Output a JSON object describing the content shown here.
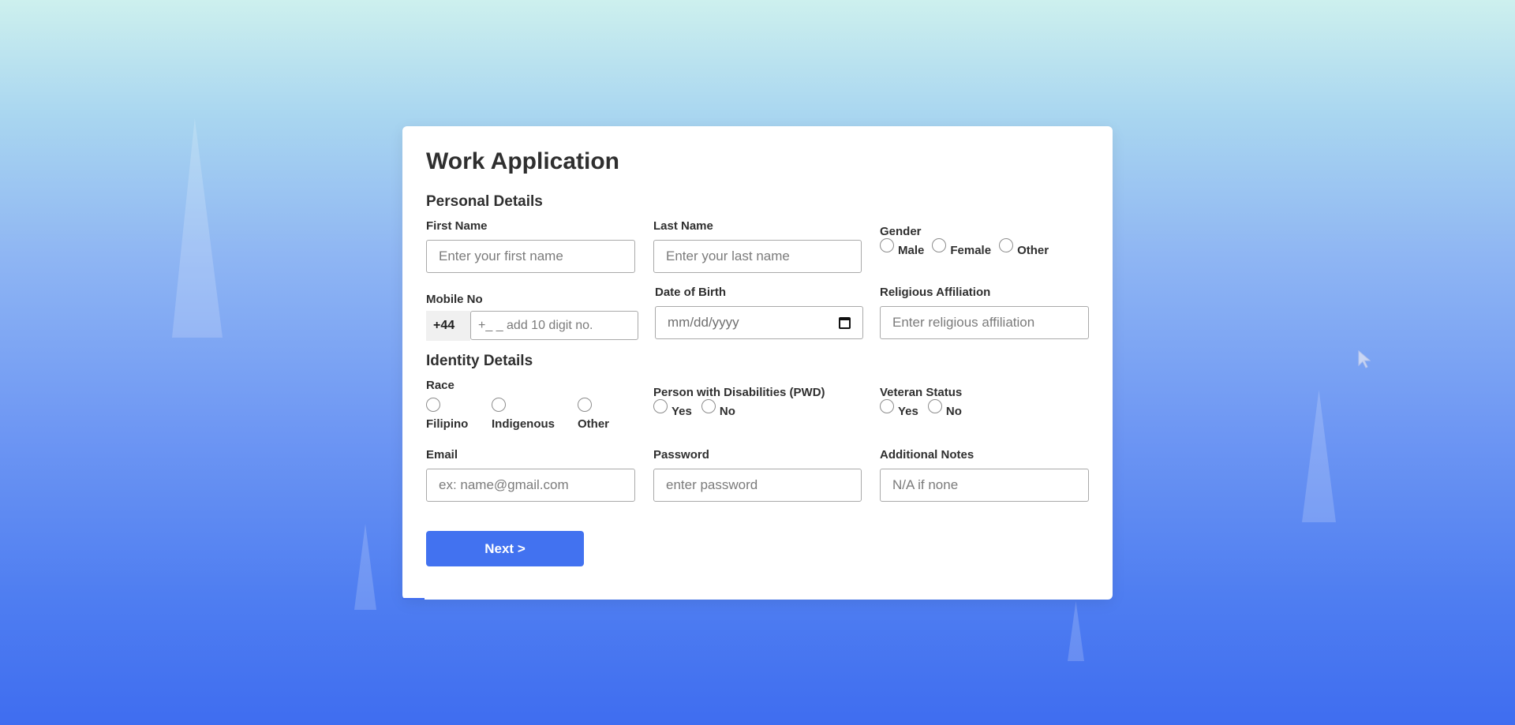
{
  "form": {
    "title": "Work Application",
    "personal_heading": "Personal Details",
    "identity_heading": "Identity Details",
    "first_name": {
      "label": "First Name",
      "placeholder": "Enter your first name"
    },
    "last_name": {
      "label": "Last Name",
      "placeholder": "Enter your last name"
    },
    "gender": {
      "label": "Gender",
      "options": [
        "Male",
        "Female",
        "Other"
      ]
    },
    "mobile": {
      "label": "Mobile No",
      "prefix": "+44",
      "placeholder": "+_ _ add 10 digit no."
    },
    "dob": {
      "label": "Date of Birth",
      "placeholder": "mm/dd/yyyy",
      "icon": "calendar-icon"
    },
    "religion": {
      "label": "Religious Affiliation",
      "placeholder": "Enter religious affiliation"
    },
    "race": {
      "label": "Race",
      "options": [
        "Filipino",
        "Indigenous",
        "Other"
      ]
    },
    "pwd": {
      "label": "Person with Disabilities (PWD)",
      "options": [
        "Yes",
        "No"
      ]
    },
    "veteran": {
      "label": "Veteran Status",
      "options": [
        "Yes",
        "No"
      ]
    },
    "email": {
      "label": "Email",
      "placeholder": "ex: name@gmail.com"
    },
    "password": {
      "label": "Password",
      "placeholder": "enter password"
    },
    "notes": {
      "label": "Additional Notes",
      "placeholder": "N/A if none"
    },
    "next_label": "Next >"
  },
  "colors": {
    "accent": "#4272f0",
    "background_top": "#cdf0ee",
    "background_bottom": "#3f6df0"
  }
}
